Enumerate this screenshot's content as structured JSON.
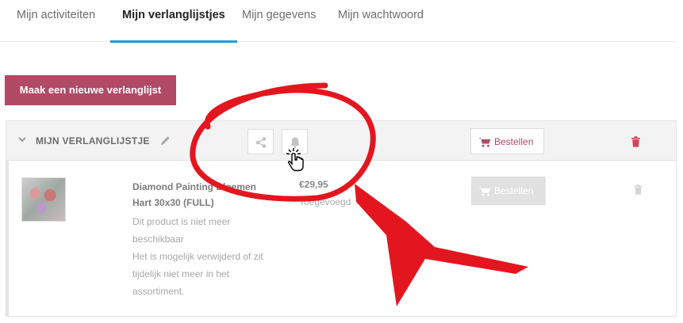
{
  "tabs": [
    {
      "label": "Mijn activiteiten",
      "active": false
    },
    {
      "label": "Mijn verlanglijstjes",
      "active": true
    },
    {
      "label": "Mijn gegevens",
      "active": false
    },
    {
      "label": "Mijn wachtwoord",
      "active": false
    }
  ],
  "new_list_button": "Maak een nieuwe verlanglijst",
  "wishlist": {
    "title": "MIJN VERLANGLIJSTJE",
    "order_label": "Bestellen",
    "icons": [
      "chevron-down-icon",
      "pencil-icon",
      "share-icon",
      "bell-icon",
      "cart-icon",
      "trash-icon"
    ],
    "items": [
      {
        "name": "Diamond Painting Bloemen Hart 30x30 (FULL)",
        "price": "€29,95",
        "added": "Toegevoegd",
        "notice_line1": "Dit product is niet meer beschikbaar",
        "notice_line2": "Het is mogelijk verwijderd of zit tijdelijk niet meer in het assortiment.",
        "order_label": "Bestellen"
      }
    ]
  },
  "colors": {
    "accent": "#b04a65",
    "tab_underline": "#1a9bd7",
    "annotation": "#e3161f",
    "disabled": "#e1e1e1"
  }
}
